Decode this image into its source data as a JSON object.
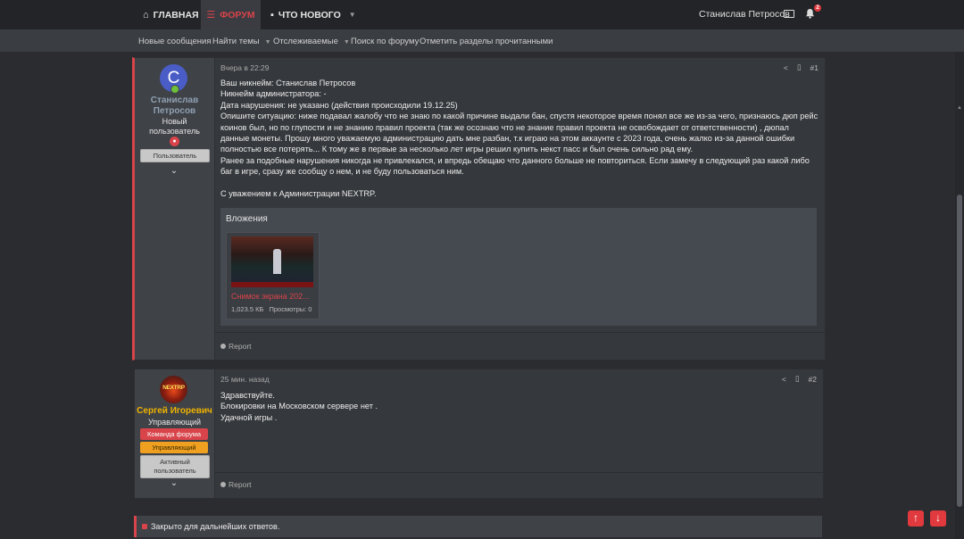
{
  "nav": {
    "home": "ГЛАВНАЯ",
    "forum": "ФОРУМ",
    "whats_new": "ЧТО НОВОГО",
    "user_name": "Станислав Петросов",
    "alerts_count": "2"
  },
  "subnav": {
    "new_messages": "Новые сообщения",
    "find_threads": "Найти темы",
    "watched": "Отслеживаемые",
    "search_forum": "Поиск по форуму",
    "mark_read": "Отметить разделы прочитанными"
  },
  "post1": {
    "avatar_letter": "С",
    "author_line1": "Станислав",
    "author_line2": "Петросов",
    "title_line1": "Новый",
    "title_line2": "пользователь",
    "badge": "Пользователь",
    "time": "Вчера в 22:29",
    "number": "#1",
    "lines": [
      "Ваш никнейм: Станислав Петросов",
      "Никнейм администратора: -",
      "Дата нарушения: не указано (действия происходили 19.12.25)",
      "Опишите ситуацию: ниже подавал жалобу что не знаю по какой причине выдали бан, спустя некоторое время понял все же из-за чего, признаюсь дюп рейс",
      "коинов был, но по глупости и не знанию правил проекта (так же осознаю что не знание правил проекта не освобождает от ответственности) , дюпал",
      "данные монеты. Прошу много уважаемую администрацию дать мне разбан, т.к играю на этом аккаунте с 2023 года, очень жалко из-за данной ошибки",
      "полностью все потерять... К тому же в первые за несколько лет игры решил купить некст пасс и был очень сильно рад ему.",
      "Ранее за подобные нарушения никогда не привлекался, и впредь обещаю что данного больше не повториться. Если замечу в следующий раз какой либо",
      "баг в игре, сразу же сообщу о нем, и не буду пользоваться ним.",
      "",
      "С уважением к Администрации NEXTRP."
    ],
    "attachments_title": "Вложения",
    "attachment_name": "Снимок экрана 202...",
    "attachment_size": "1,023.5 КБ",
    "attachment_views": "Просмотры: 0",
    "report": "Report"
  },
  "post2": {
    "avatar_text": "NEXTRP",
    "author": "Сергей Игоревич",
    "title": "Управляющий",
    "badge1": "Команда форума",
    "badge2": "Управляющий",
    "badge3_line1": "Активный",
    "badge3_line2": "пользователь",
    "time": "25 мин. назад",
    "number": "#2",
    "lines": [
      "Здравствуйте.",
      "Блокировки на Московском сервере нет .",
      "Удачной игры ."
    ],
    "report": "Report"
  },
  "closed": "Закрыто для дальнейших ответов.",
  "colors": {
    "accent": "#d8444a",
    "author1": "#8fa0b2",
    "author2": "#f0b400"
  }
}
